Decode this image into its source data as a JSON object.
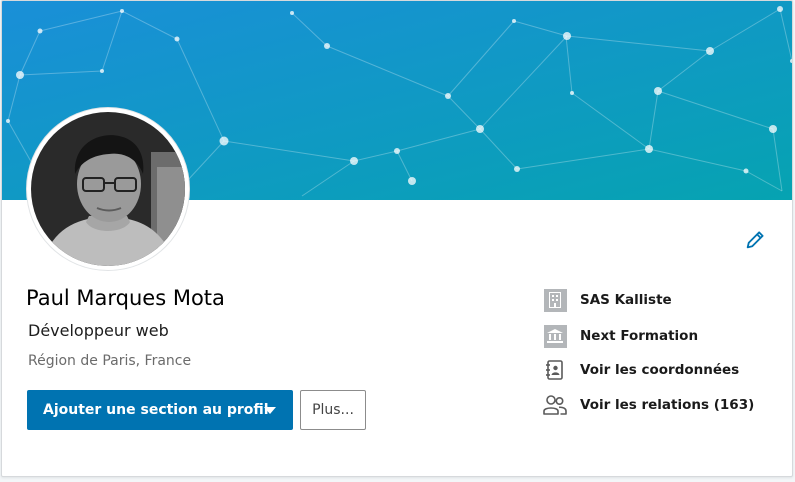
{
  "profile": {
    "name": "Paul Marques Mota",
    "headline": "Développeur web",
    "location": "Région de Paris, France"
  },
  "actions": {
    "add_section_label": "Ajouter une section au profil",
    "more_label": "Plus..."
  },
  "sidebar": {
    "items": [
      {
        "label": "SAS Kalliste",
        "icon": "building-icon"
      },
      {
        "label": "Next Formation",
        "icon": "school-icon"
      },
      {
        "label": "Voir les coordonnées",
        "icon": "contact-card-icon"
      },
      {
        "label": "Voir les relations (163)",
        "icon": "people-icon"
      }
    ]
  },
  "colors": {
    "banner_start": "#1a8fd8",
    "banner_end": "#06a3b1",
    "primary_button": "#0073b1",
    "edit_icon": "#0073b1",
    "sidebar_icon": "#b3b6b9"
  }
}
